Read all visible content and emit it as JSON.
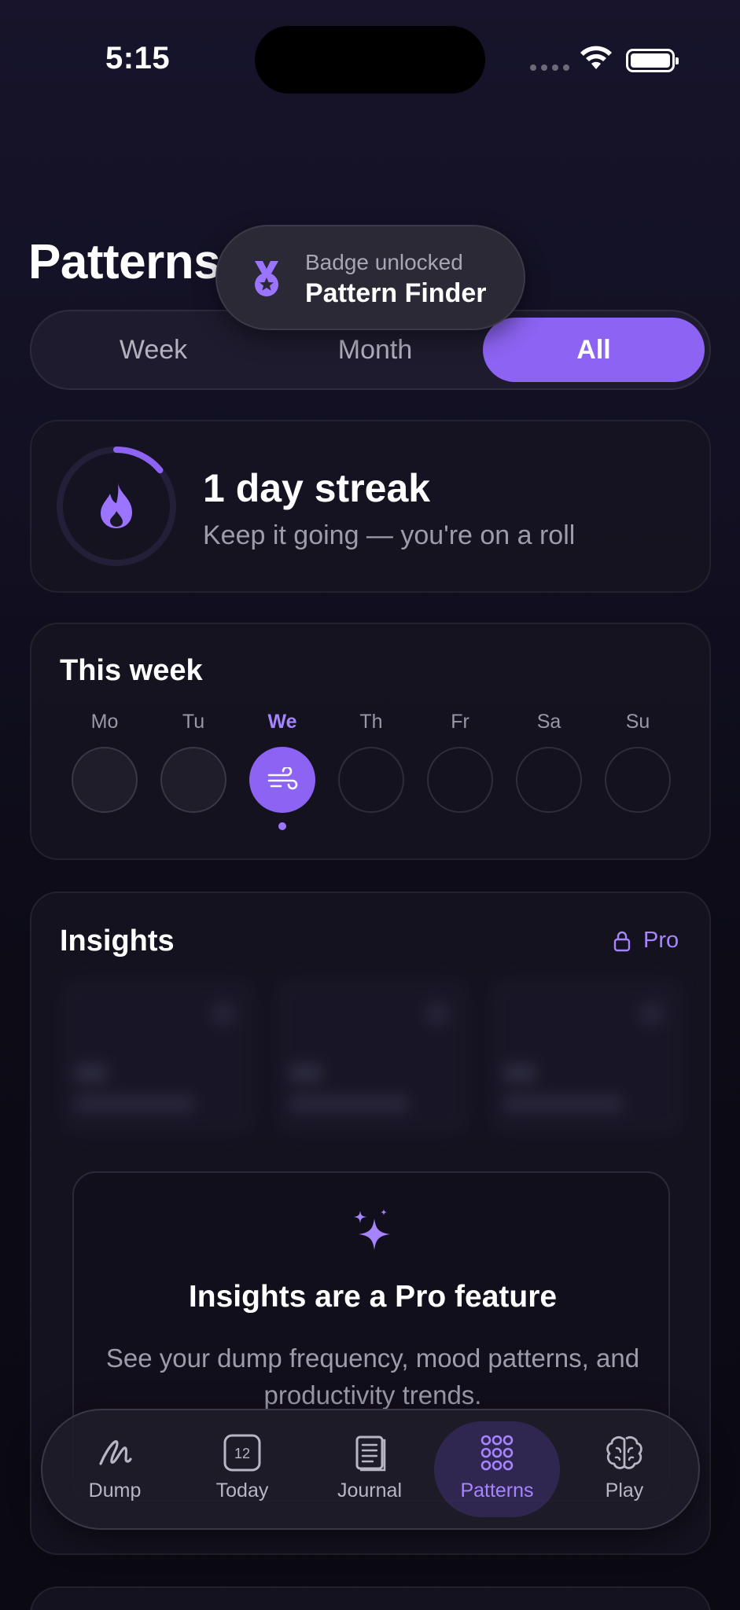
{
  "status_bar": {
    "time": "5:15"
  },
  "page": {
    "title": "Patterns"
  },
  "toast": {
    "subtitle": "Badge unlocked",
    "title": "Pattern Finder"
  },
  "segments": {
    "week": "Week",
    "month": "Month",
    "all": "All",
    "selected": "All"
  },
  "streak": {
    "title": "1 day streak",
    "subtitle": "Keep it going — you're on a roll",
    "progress": 0.14
  },
  "this_week": {
    "title": "This week",
    "days": [
      {
        "label": "Mo",
        "state": "filled"
      },
      {
        "label": "Tu",
        "state": "filled"
      },
      {
        "label": "We",
        "state": "active"
      },
      {
        "label": "Th",
        "state": "empty"
      },
      {
        "label": "Fr",
        "state": "empty"
      },
      {
        "label": "Sa",
        "state": "empty"
      },
      {
        "label": "Su",
        "state": "empty"
      }
    ]
  },
  "insights": {
    "title": "Insights",
    "pro_label": "Pro",
    "pro_title": "Insights are a Pro feature",
    "pro_description": "See your dump frequency, mood patterns, and productivity trends."
  },
  "tabs": {
    "dump": "Dump",
    "today": "Today",
    "today_day": "12",
    "journal": "Journal",
    "patterns": "Patterns",
    "play": "Play",
    "active": "Patterns"
  },
  "colors": {
    "accent": "#8c63f2",
    "accent_text": "#a784ff",
    "background": "#110f20"
  }
}
